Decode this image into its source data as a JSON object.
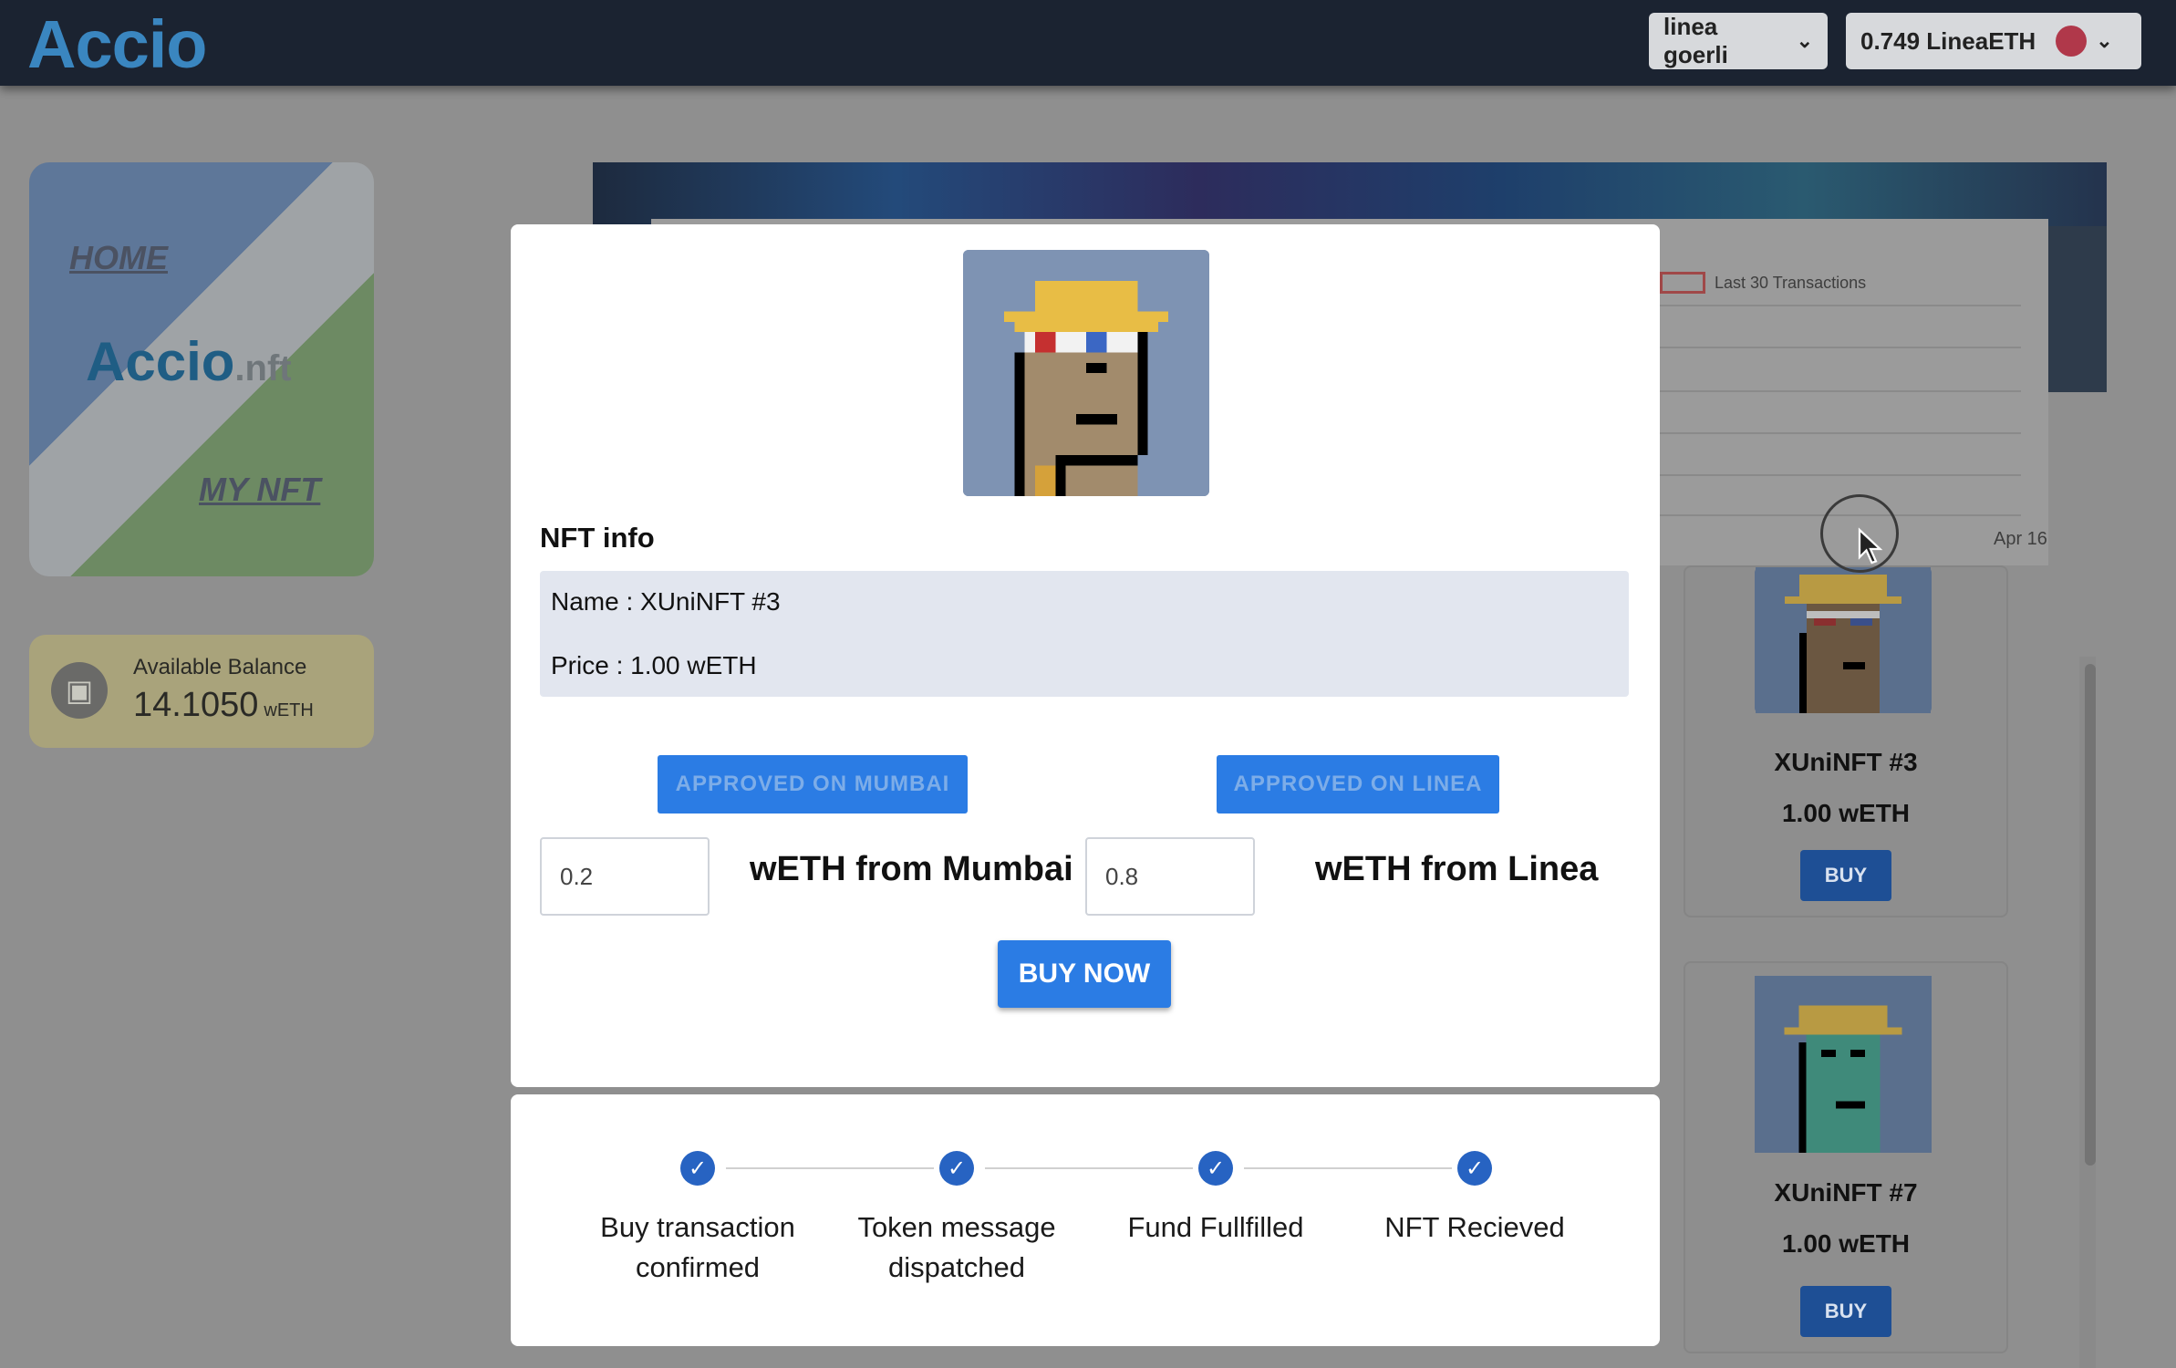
{
  "header": {
    "logo": "Accio",
    "network": "linea goerli",
    "wallet_balance": "0.749 LineaETH"
  },
  "sidebar": {
    "home": "HOME",
    "logo_main": "Accio",
    "logo_suffix": ".nft",
    "my_nft": "MY NFT"
  },
  "balance": {
    "label": "Available Balance",
    "value": "14.1050",
    "unit": "wETH"
  },
  "chart": {
    "legend": "Last 30 Transactions",
    "x_tick": "Apr 16"
  },
  "cards": [
    {
      "name": "XUniNFT #3",
      "price": "1.00 wETH",
      "button": "BUY"
    },
    {
      "name": "XUniNFT #7",
      "price": "1.00 wETH",
      "button": "BUY"
    }
  ],
  "modal": {
    "info_title": "NFT info",
    "name_line": "Name : XUniNFT #3",
    "price_line": "Price : 1.00 wETH",
    "approve_mumbai": "APPROVED ON MUMBAI",
    "approve_linea": "APPROVED ON LINEA",
    "mumbai_amount": "0.2",
    "mumbai_label": "wETH from Mumbai",
    "linea_amount": "0.8",
    "linea_label": "wETH from Linea",
    "buy_now": "BUY NOW"
  },
  "progress": {
    "steps": [
      {
        "line1": "Buy transaction",
        "line2": "confirmed"
      },
      {
        "line1": "Token message",
        "line2": "dispatched"
      },
      {
        "line1": "Fund Fullfilled",
        "line2": ""
      },
      {
        "line1": "NFT Recieved",
        "line2": ""
      }
    ]
  },
  "colors": {
    "topbar": "#1b2331",
    "accent": "#2b7ce4",
    "step_check": "#2763c2"
  }
}
